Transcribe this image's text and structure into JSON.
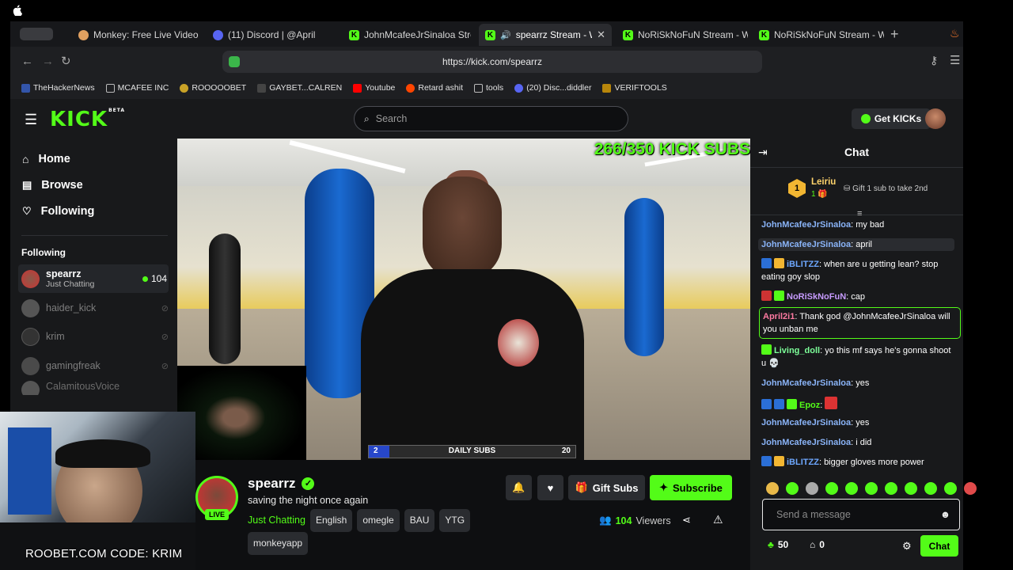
{
  "browser": {
    "tabs": [
      {
        "title": "Monkey: Free Live Video C",
        "active": false
      },
      {
        "title": "(11) Discord | @April",
        "active": false
      },
      {
        "title": "JohnMcafeeJrSinaloa Strea",
        "active": false
      },
      {
        "title": "spearrz Stream - Wa",
        "active": true
      },
      {
        "title": "NoRiSkNoFuN Stream - Wa",
        "active": false
      },
      {
        "title": "NoRiSkNoFuN Stream - Wa",
        "active": false
      }
    ],
    "url": "https://kick.com/spearrz",
    "bookmarks": [
      "TheHackerNews",
      "MCAFEE INC",
      "ROOOOOBET",
      "GAYBET...CALREN",
      "Youtube",
      "Retard ashit",
      "tools",
      "(20) Disc...diddler",
      "VERIFTOOLS"
    ]
  },
  "header": {
    "search_placeholder": "Search",
    "get_kicks_label": "Get KICKs",
    "logo_text": "KICK",
    "logo_beta": "BETA"
  },
  "sidebar": {
    "nav": [
      {
        "label": "Home",
        "icon": "home-icon"
      },
      {
        "label": "Browse",
        "icon": "browse-icon"
      },
      {
        "label": "Following",
        "icon": "heart-icon"
      }
    ],
    "following_header": "Following",
    "following": [
      {
        "name": "spearrz",
        "category": "Just Chatting",
        "viewers": "104",
        "live": true
      },
      {
        "name": "haider_kick",
        "live": false
      },
      {
        "name": "krim",
        "live": false
      },
      {
        "name": "gamingfreak",
        "live": false
      },
      {
        "name": "CalamitousVoice",
        "live": false
      }
    ]
  },
  "video": {
    "overlay_subs": "266/350 KICK SUBS",
    "daily_subs_left": "2",
    "daily_subs_label": "DAILY SUBS",
    "daily_subs_right": "20",
    "daily_subs_progress": 0.1
  },
  "streamer": {
    "name": "spearrz",
    "title": "saving the night once again",
    "category": "Just Chatting",
    "tags": [
      "English",
      "omegle",
      "BAU",
      "YTG",
      "monkeyapp"
    ],
    "live_badge": "LIVE",
    "viewers": "104",
    "viewers_label": "Viewers",
    "gift_subs_label": "Gift Subs",
    "subscribe_label": "Subscribe"
  },
  "webcam_overlay_text": "ROOBET.COM CODE: KRIM",
  "chat": {
    "title": "Chat",
    "top_gifter": {
      "rank": "1",
      "name": "Leiriu",
      "count": "1",
      "cta": "Gift 1 sub to take 2nd"
    },
    "messages": [
      {
        "user": "JohnMcafeeJrSinaloa",
        "color": "#8ab4f8",
        "text": "my bad"
      },
      {
        "user": "JohnMcafeeJrSinaloa",
        "color": "#8ab4f8",
        "text": "april"
      },
      {
        "user": "iBLITZZ",
        "color": "#6ea8ff",
        "text": "when are u getting lean? stop eating goy slop"
      },
      {
        "user": "NoRiSkNoFuN",
        "color": "#c79bff",
        "text": "cap"
      },
      {
        "user": "April2i1",
        "color": "#ff7aa2",
        "text": "Thank god @JohnMcafeeJrSinaloa will you unban me"
      },
      {
        "user": "Living_doll",
        "color": "#7dff9a",
        "text": "yo this mf says he's gonna shoot u 💀"
      },
      {
        "user": "JohnMcafeeJrSinaloa",
        "color": "#8ab4f8",
        "text": "yes"
      },
      {
        "user": "Epoz",
        "color": "#53fc18",
        "text": ""
      },
      {
        "user": "JohnMcafeeJrSinaloa",
        "color": "#8ab4f8",
        "text": "yes"
      },
      {
        "user": "JohnMcafeeJrSinaloa",
        "color": "#8ab4f8",
        "text": "i did"
      },
      {
        "user": "iBLITZZ",
        "color": "#6ea8ff",
        "text": "bigger gloves more power"
      }
    ],
    "input_placeholder": "Send a message",
    "kicks_count": "50",
    "store_count": "0",
    "send_label": "Chat"
  },
  "colors": {
    "brand": "#53fc18",
    "bg": "#0e0f11",
    "panel": "#18191b"
  }
}
